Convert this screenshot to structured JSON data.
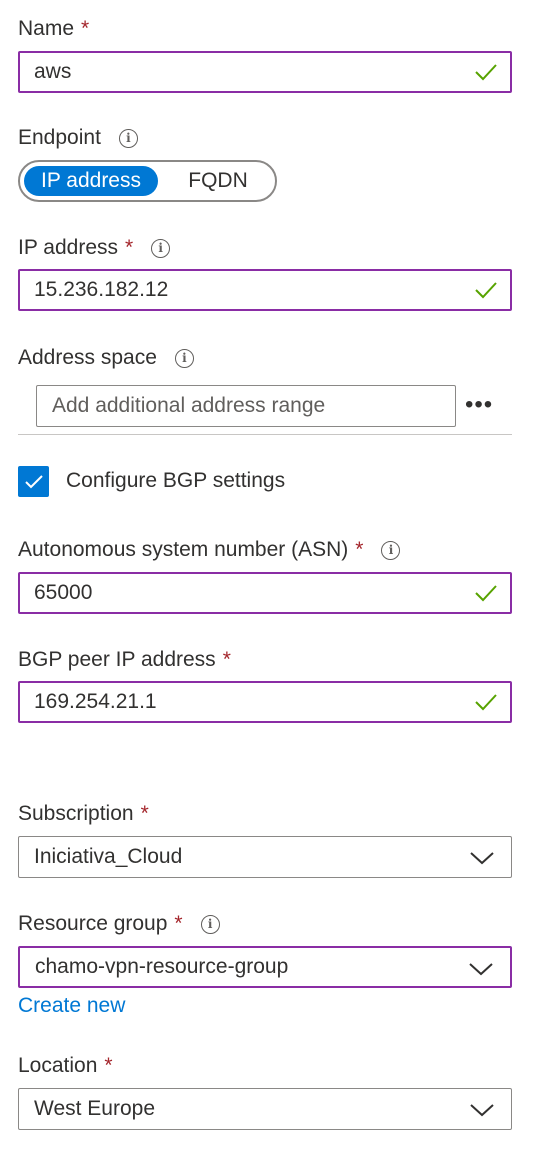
{
  "name": {
    "label": "Name",
    "required": "*",
    "value": "aws",
    "valid_icon": "checkmark-icon"
  },
  "endpoint": {
    "label": "Endpoint",
    "info_icon": "info-icon",
    "options": [
      "IP address",
      "FQDN"
    ],
    "selected": "IP address"
  },
  "ip_address": {
    "label": "IP address",
    "required": "*",
    "value": "15.236.182.12",
    "info_icon": "info-icon"
  },
  "address_space": {
    "label": "Address space",
    "placeholder": "Add additional address range",
    "more": "•••"
  },
  "bgp": {
    "checkbox_label": "Configure BGP settings",
    "checked": true
  },
  "asn": {
    "label": "Autonomous system number (ASN)",
    "required": "*",
    "value": "65000"
  },
  "bgp_peer": {
    "label": "BGP peer IP address",
    "required": "*",
    "value": "169.254.21.1"
  },
  "subscription": {
    "label": "Subscription",
    "required": "*",
    "value": "Iniciativa_Cloud"
  },
  "resource_group": {
    "label": "Resource group",
    "required": "*",
    "value": "chamo-vpn-resource-group",
    "create_new": "Create new"
  },
  "location": {
    "label": "Location",
    "required": "*",
    "value": "West Europe"
  },
  "colors": {
    "accent": "#0078d4",
    "focus_border": "#8a2da5",
    "valid": "#57a300",
    "required": "#a4262c"
  }
}
